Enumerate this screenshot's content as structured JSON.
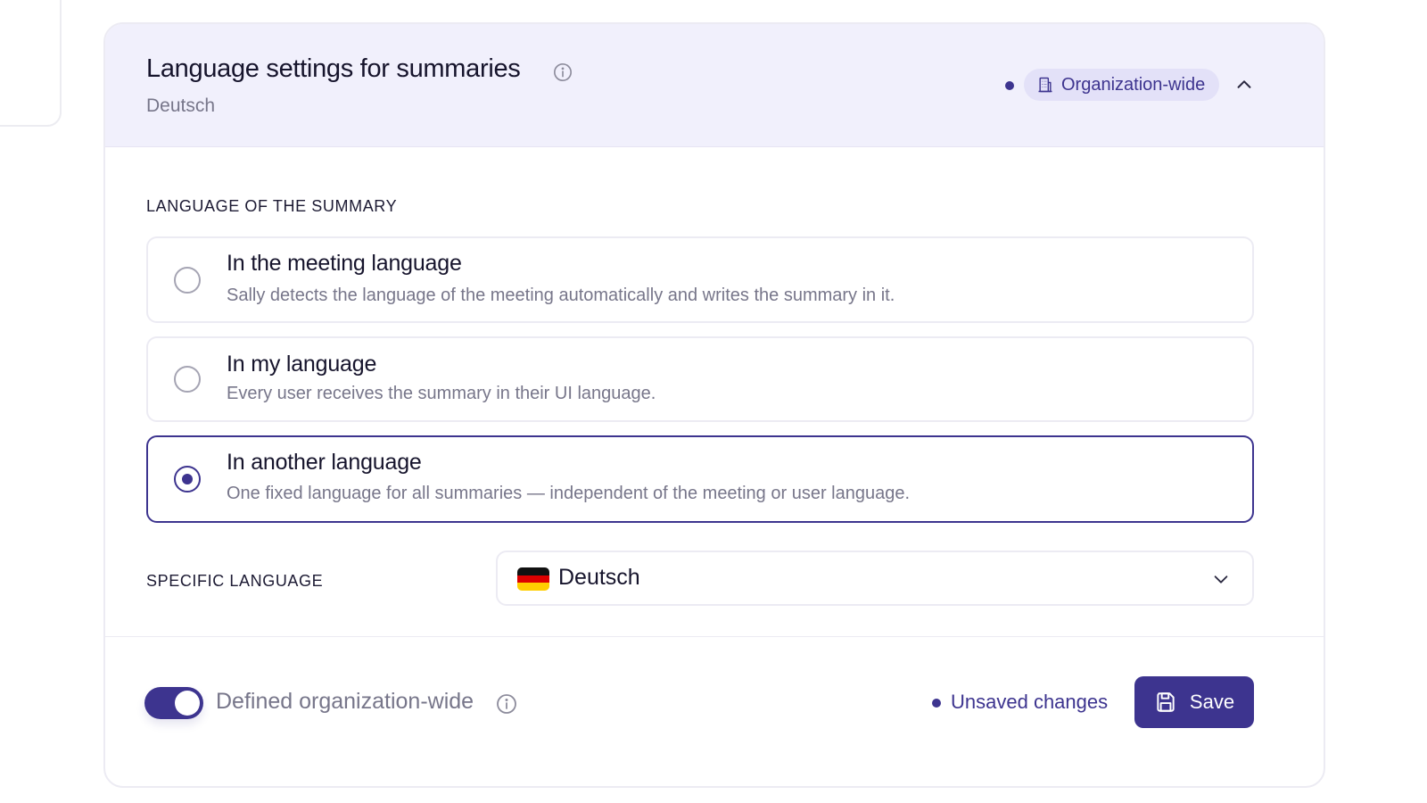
{
  "header": {
    "title": "Language settings for summaries",
    "subtitle": "Deutsch",
    "scope_badge": "Organization-wide",
    "info_icon": "info-icon",
    "collapse_icon": "chevron-up-icon",
    "badge_icon": "building-icon"
  },
  "language_section": {
    "label": "LANGUAGE OF THE SUMMARY",
    "selected_index": 2,
    "options": [
      {
        "title": "In the meeting language",
        "description": "Sally detects the language of the meeting automatically and writes the summary in it."
      },
      {
        "title": "In my language",
        "description": "Every user receives the summary in their UI language."
      },
      {
        "title": "In another language",
        "description": "One fixed language for all summaries — independent of the meeting or user language."
      }
    ]
  },
  "specific_language": {
    "label": "SPECIFIC LANGUAGE",
    "value": "Deutsch",
    "flag_icon": "german-flag-icon",
    "dropdown_icon": "chevron-down-icon"
  },
  "footer": {
    "toggle_label": "Defined organization-wide",
    "toggle_on": true,
    "status_text": "Unsaved changes",
    "save_label": "Save",
    "save_icon": "floppy-disk-icon"
  },
  "colors": {
    "accent": "#3d348f",
    "header_bg": "#f1f0fc",
    "badge_bg": "#e3e1f8",
    "muted_text": "#77768a"
  }
}
